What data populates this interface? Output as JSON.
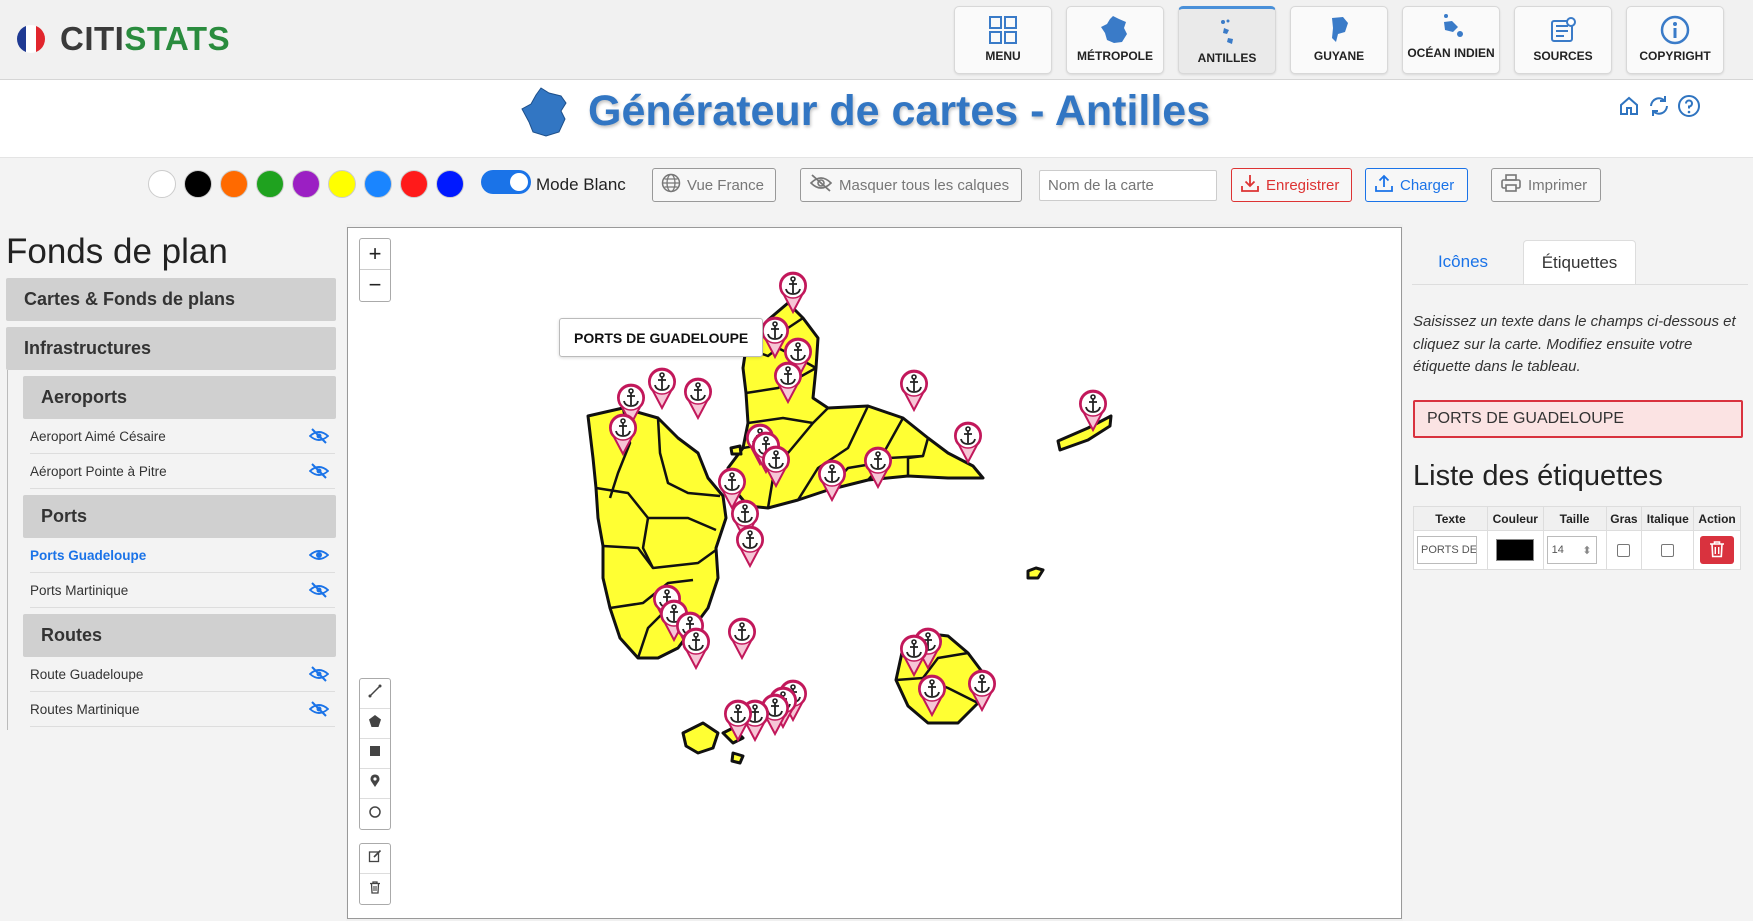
{
  "header": {
    "logo_part1": "CITI",
    "logo_part2": "STATS",
    "nav": [
      {
        "label": "MENU",
        "icon": "grid-icon"
      },
      {
        "label": "MÉTROPOLE",
        "icon": "france-map-icon"
      },
      {
        "label": "ANTILLES",
        "icon": "antilles-map-icon",
        "active": true
      },
      {
        "label": "GUYANE",
        "icon": "guyane-map-icon"
      },
      {
        "label": "OCÉAN INDIEN",
        "icon": "ocean-indien-map-icon"
      },
      {
        "label": "SOURCES",
        "icon": "sources-icon"
      },
      {
        "label": "COPYRIGHT",
        "icon": "info-icon"
      }
    ]
  },
  "page": {
    "title": "Générateur de cartes - Antilles"
  },
  "toolbar": {
    "colors": [
      "#ffffff",
      "#000000",
      "#ff6a00",
      "#1fa21f",
      "#9b1fc3",
      "#ffff00",
      "#1a85ff",
      "#ff1a1a",
      "#0019ff"
    ],
    "mode_label": "Mode Blanc",
    "vue_france": "Vue France",
    "hide_layers": "Masquer tous les calques",
    "map_name_placeholder": "Nom de la carte",
    "save": "Enregistrer",
    "load": "Charger",
    "print": "Imprimer"
  },
  "left": {
    "title": "Fonds de plan",
    "sections": {
      "cartes": "Cartes & Fonds de plans",
      "infra": "Infrastructures",
      "aeroports": "Aeroports",
      "ports": "Ports",
      "routes": "Routes"
    },
    "layers": {
      "aero1": "Aeroport Aimé Césaire",
      "aero2": "Aéroport Pointe à Pitre",
      "port1": "Ports Guadeloupe",
      "port2": "Ports Martinique",
      "route1": "Route Guadeloupe",
      "route2": "Routes Martinique"
    }
  },
  "map": {
    "label": "PORTS DE GUADELOUPE",
    "zoom_in": "+",
    "zoom_out": "−",
    "fill_color": "#ffff33"
  },
  "right": {
    "tabs": [
      "Icônes",
      "Étiquettes"
    ],
    "help": "Saisissez un texte dans le champs ci-dessous et cliquez sur la carte. Modifiez ensuite votre étiquette dans le tableau.",
    "input_value": "PORTS DE GUADELOUPE",
    "list_title": "Liste des étiquettes",
    "columns": [
      "Texte",
      "Couleur",
      "Taille",
      "Gras",
      "Italique",
      "Action"
    ],
    "row": {
      "text": "PORTS DE GUADELOUPE",
      "size": "14"
    }
  }
}
